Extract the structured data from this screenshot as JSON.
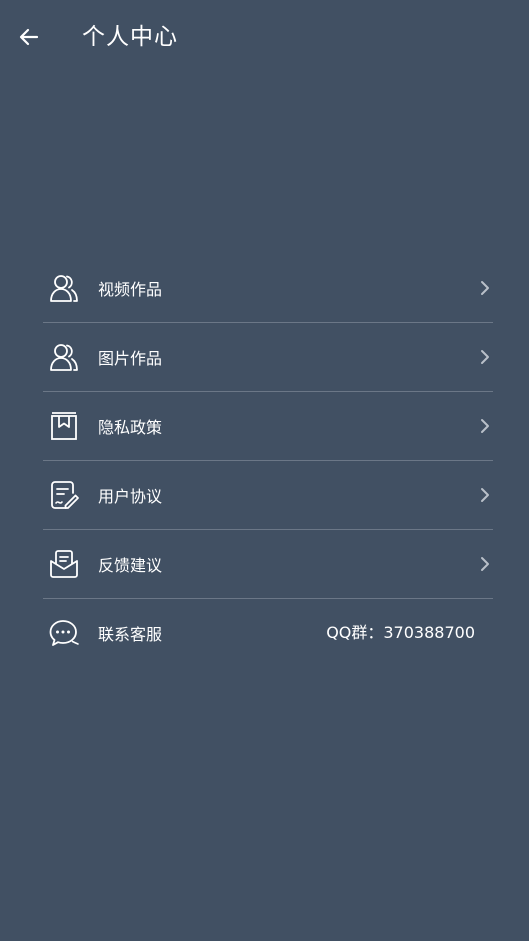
{
  "header": {
    "title": "个人中心"
  },
  "menu": {
    "items": [
      {
        "label": "视频作品",
        "icon": "user-icon"
      },
      {
        "label": "图片作品",
        "icon": "user-icon"
      },
      {
        "label": "隐私政策",
        "icon": "bookmark-book-icon"
      },
      {
        "label": "用户协议",
        "icon": "document-edit-icon"
      },
      {
        "label": "反馈建议",
        "icon": "mail-icon"
      },
      {
        "label": "联系客服",
        "icon": "chat-bubble-icon",
        "value": "QQ群：370388700"
      }
    ]
  },
  "colors": {
    "background": "#415063",
    "divider": "#6b7787",
    "chevron": "#b9c0c9",
    "text": "#ffffff"
  }
}
